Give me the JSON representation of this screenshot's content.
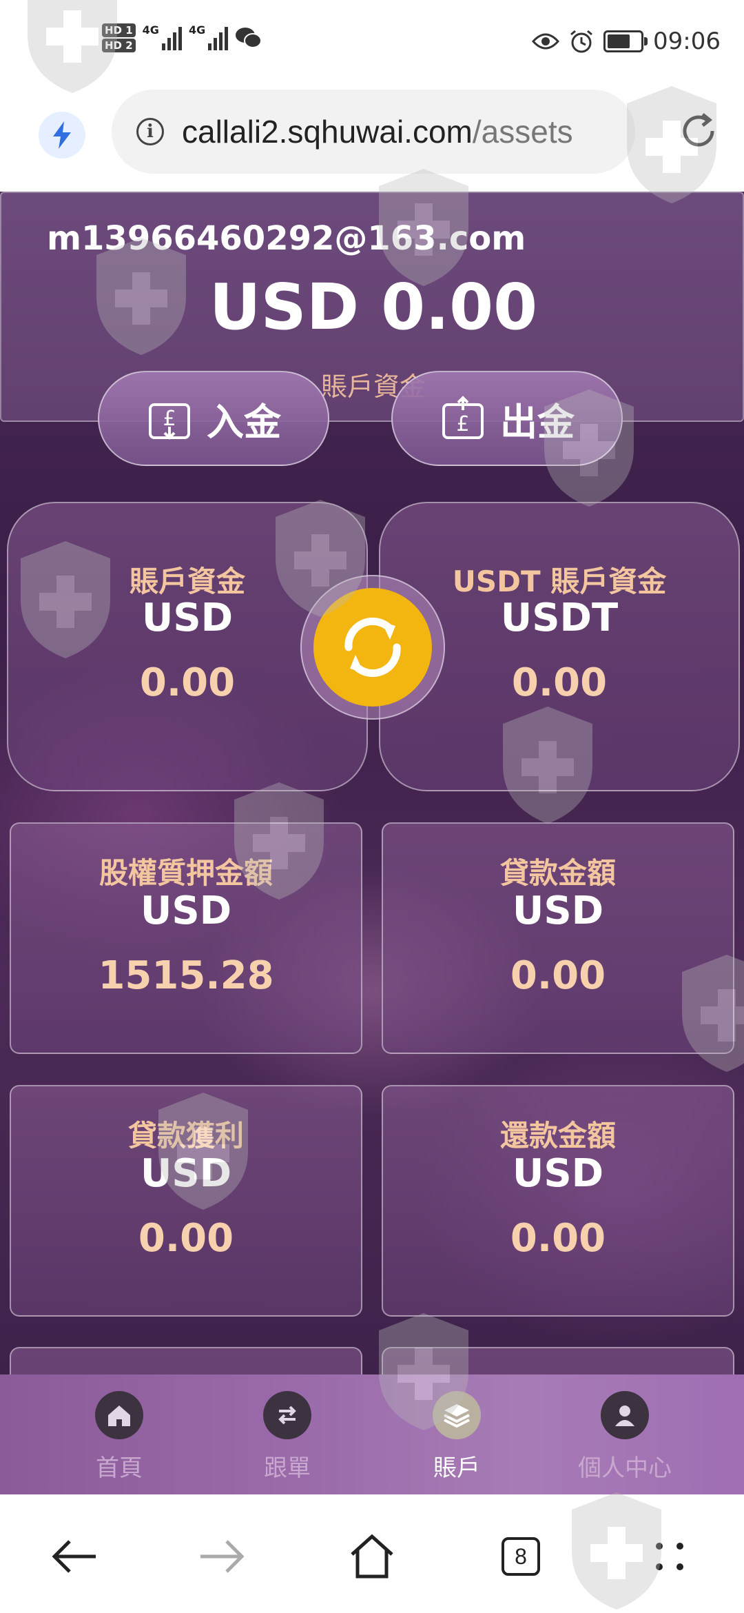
{
  "status_bar": {
    "hd1": "HD 1",
    "hd2": "HD 2",
    "net1": "4G",
    "net2": "4G",
    "time": "09:06",
    "battery_level": 0.8,
    "icons": [
      "wechat-icon",
      "eye-icon",
      "alarm-icon",
      "battery-icon"
    ]
  },
  "browser": {
    "url_host": "callali2.sqhuwai.com",
    "url_path": "/assets",
    "tabs_count": "8"
  },
  "account": {
    "email": "m13966460292@163.com",
    "total": "USD 0.00",
    "total_label": "賬戶資金"
  },
  "actions": {
    "deposit": "入金",
    "withdraw": "出金"
  },
  "wallets": [
    {
      "title": "賬戶資金",
      "currency": "USD",
      "value": "0.00"
    },
    {
      "title": "USDT 賬戶資金",
      "currency": "USDT",
      "value": "0.00"
    }
  ],
  "stats": [
    {
      "title": "股權質押金額",
      "currency": "USD",
      "value": "1515.28"
    },
    {
      "title": "貸款金額",
      "currency": "USD",
      "value": "0.00"
    },
    {
      "title": "貸款獲利",
      "currency": "USD",
      "value": "0.00"
    },
    {
      "title": "還款金額",
      "currency": "USD",
      "value": "0.00"
    }
  ],
  "tabbar": [
    {
      "label": "首頁",
      "icon": "home-icon",
      "active": false
    },
    {
      "label": "跟單",
      "icon": "swap-icon",
      "active": false
    },
    {
      "label": "賬戶",
      "icon": "layers-icon",
      "active": true
    },
    {
      "label": "個人中心",
      "icon": "user-icon",
      "active": false
    }
  ],
  "colors": {
    "accent_gold": "#f3b50f",
    "label_peach": "#f3c69f",
    "background_purple": "#4a2a55"
  }
}
